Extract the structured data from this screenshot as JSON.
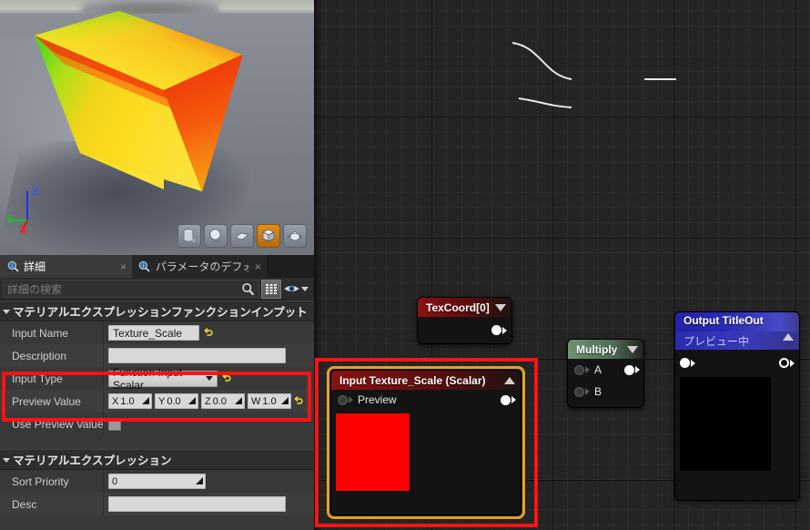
{
  "viewport": {
    "name": "material-preview-viewport",
    "axis_gizmo": {
      "z": "Z",
      "y": "Y",
      "x": "X"
    },
    "shape_buttons": [
      {
        "name": "cylinder",
        "label": "Cylinder",
        "selected": false
      },
      {
        "name": "sphere",
        "label": "Sphere",
        "selected": false
      },
      {
        "name": "plane",
        "label": "Plane",
        "selected": false
      },
      {
        "name": "cube",
        "label": "Cube",
        "selected": true
      },
      {
        "name": "teapot",
        "label": "Teapot",
        "selected": false
      }
    ]
  },
  "details_panel": {
    "tabs": [
      {
        "label": "詳細",
        "icon": "details-magnifier-icon",
        "active": true,
        "close": "×"
      },
      {
        "label": "パラメータのデフォル",
        "icon": "details-magnifier-icon",
        "active": false,
        "close": "×"
      }
    ],
    "search": {
      "placeholder": "詳細の検索",
      "value": "",
      "icon": "search-icon"
    },
    "toolbar": {
      "grid_icon": "grid-view-icon",
      "eye_icon": "eye-visibility-icon",
      "caret_icon": "chevron-down-icon"
    },
    "categories": [
      {
        "title": "マテリアルエクスプレッションファンクションインプット",
        "rows": [
          {
            "label": "Input Name",
            "type": "text",
            "value": "Texture_Scale",
            "revert": true
          },
          {
            "label": "Description",
            "type": "text",
            "value": "",
            "revert": false
          },
          {
            "label": "Input Type",
            "type": "combo",
            "value": "Function Input Scalar",
            "revert": true
          },
          {
            "label": "Preview Value",
            "type": "vector4",
            "components": [
              {
                "axis": "X",
                "value": "1.0"
              },
              {
                "axis": "Y",
                "value": "0.0"
              },
              {
                "axis": "Z",
                "value": "0.0"
              },
              {
                "axis": "W",
                "value": "1.0"
              }
            ],
            "revert": true
          },
          {
            "label": "Use Preview Value a",
            "type": "checkbox",
            "checked": false,
            "revert": false
          }
        ]
      },
      {
        "title": "マテリアルエクスプレッション",
        "rows": [
          {
            "label": "Sort Priority",
            "type": "number",
            "value": "0",
            "revert": false
          },
          {
            "label": "Desc",
            "type": "text",
            "value": "",
            "revert": false
          }
        ]
      }
    ]
  },
  "graph": {
    "name": "material-function-graph",
    "nodes": [
      {
        "id": "texcoord",
        "title": "TexCoord[0]",
        "header_color": "#8a1212",
        "collapse_icon": "chevron-down-icon",
        "output_pin": "output-pin"
      },
      {
        "id": "input-texture-scale",
        "title": "Input Texture_Scale (Scalar)",
        "header_color": "#8a1212",
        "collapse_icon": "chevron-up-icon",
        "pin_label": "Preview",
        "selected": true,
        "preview_swatch_color": "#ff0000"
      },
      {
        "id": "multiply",
        "title": "Multiply",
        "header_color": "#6c9471",
        "collapse_icon": "chevron-down-icon",
        "inputs": [
          "A",
          "B"
        ],
        "output_pin": "output-pin"
      },
      {
        "id": "output-titleout",
        "title": "Output TitleOut",
        "subtitle": "プレビュー中",
        "header_color": "#2a2ab4",
        "collapse_icon": "chevron-up-icon",
        "preview_swatch_color": "#000000"
      }
    ]
  },
  "highlights": {
    "accent_color": "#ff1212",
    "selection_color": "#e8a020",
    "boxes": [
      {
        "name": "details-input-type-preview-value-highlight"
      },
      {
        "name": "graph-input-node-highlight"
      }
    ]
  }
}
